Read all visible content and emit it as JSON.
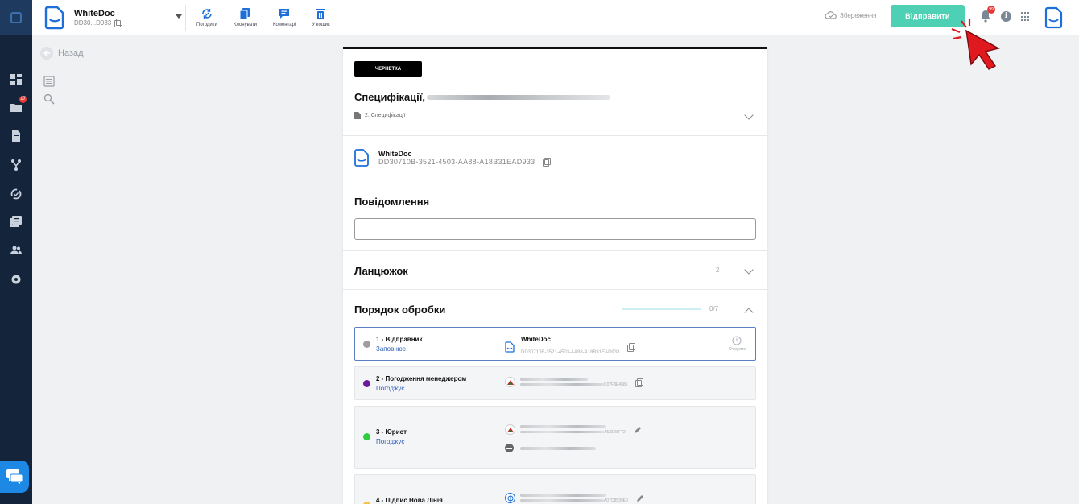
{
  "topbar": {
    "doc_name": "WhiteDoc",
    "doc_short_id": "DD30...D933",
    "tools": [
      {
        "label": "Погодити",
        "icon": "approve-cycle-icon"
      },
      {
        "label": "Клонувати",
        "icon": "clone-icon"
      },
      {
        "label": "Коментарі",
        "icon": "comments-icon"
      },
      {
        "label": "У кошик",
        "icon": "trash-icon"
      }
    ],
    "save_status": "Збереження",
    "send_label": "Відправити",
    "notifications_badge": "99",
    "colors": {
      "accent": "#4dd0b4",
      "brand": "#1e6fd9",
      "rail": "#14243a"
    }
  },
  "rail": {
    "folders_badge": "17",
    "items": [
      "dashboard-icon",
      "folder-icon",
      "document-icon",
      "routes-icon",
      "approvals-icon",
      "registry-icon",
      "users-icon",
      "settings-icon"
    ]
  },
  "side": {
    "back_label": "Назад"
  },
  "card": {
    "status_badge": "ЧЕРНЕТКА",
    "title_prefix": "Специфікації,",
    "subtitle": "2. Специфікації",
    "entity_name": "WhiteDoc",
    "entity_id": "DD30710B-3521-4503-AA88-A18B31EAD933",
    "message_title": "Повідомлення",
    "message_value": "",
    "chain_title": "Ланцюжок",
    "chain_count": "2",
    "order_title": "Порядок обробки",
    "order_count": "0/7",
    "order_progress": 0
  },
  "steps": [
    {
      "title": "1 - Відправник",
      "role": "Заповнює",
      "dot_color": "#9e9e9e",
      "entity_name": "WhiteDoc",
      "entity_id": "DD30710B-3521-4503-AA88-A18B31EAD933",
      "status": "Очікуємо"
    },
    {
      "title": "2 - Погодження менеджером",
      "role": "Погоджує",
      "dot_color": "#6a1b9a",
      "id_tail": "C07F3E4585"
    },
    {
      "title": "3 - Юрист",
      "role": "Погоджує",
      "dot_color": "#2ecc40",
      "id_tail": "A523D8F72"
    },
    {
      "title": "4 - Підпис Нова Лінія",
      "role": "",
      "dot_color": "#f5c242",
      "id_tail": "A07C8539E0"
    }
  ]
}
